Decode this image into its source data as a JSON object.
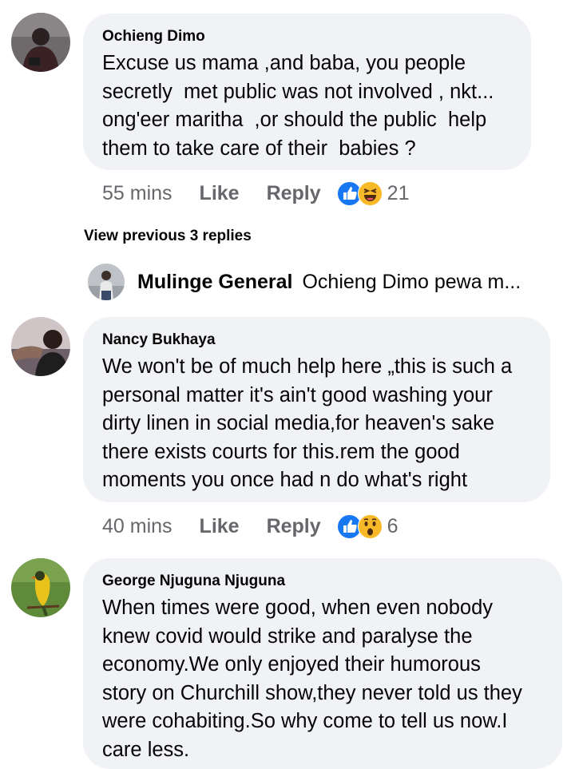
{
  "comments": [
    {
      "author": "Ochieng Dimo",
      "text": "Excuse us mama ,and baba, you people\nsecretly  met public was not involved , nkt...\nong'eer maritha  ,or should the public  help\nthem to take care of their  babies ?",
      "time": "55 mins",
      "like_label": "Like",
      "reply_label": "Reply",
      "reaction_icons": [
        "like-icon",
        "haha-icon"
      ],
      "reaction_count": "21"
    },
    {
      "author": "Nancy Bukhaya",
      "text": "We won't be of much help here „this is such a\npersonal matter it's ain't good washing your\ndirty linen in social media,for heaven's sake\nthere exists courts for this.rem the good\nmoments you once had n do what's right",
      "time": "40 mins",
      "like_label": "Like",
      "reply_label": "Reply",
      "reaction_icons": [
        "like-icon",
        "wow-icon"
      ],
      "reaction_count": "6"
    },
    {
      "author": "George Njuguna Njuguna",
      "text": "When times were good, when even nobody\nknew covid would strike and paralyse the\neconomy.We only enjoyed their humorous\nstory on Churchill show,they never told us they\nwere cohabiting.So why come to tell us now.I\ncare less."
    }
  ],
  "view_previous_label": "View previous 3 replies",
  "reply_preview": {
    "author": "Mulinge General",
    "snippet": "Ochieng Dimo pewa m..."
  },
  "colors": {
    "bubble": "#f0f2f5",
    "meta_text": "#65676b",
    "like_blue": "#1877f2",
    "emoji_yellow": "#f7b928"
  }
}
